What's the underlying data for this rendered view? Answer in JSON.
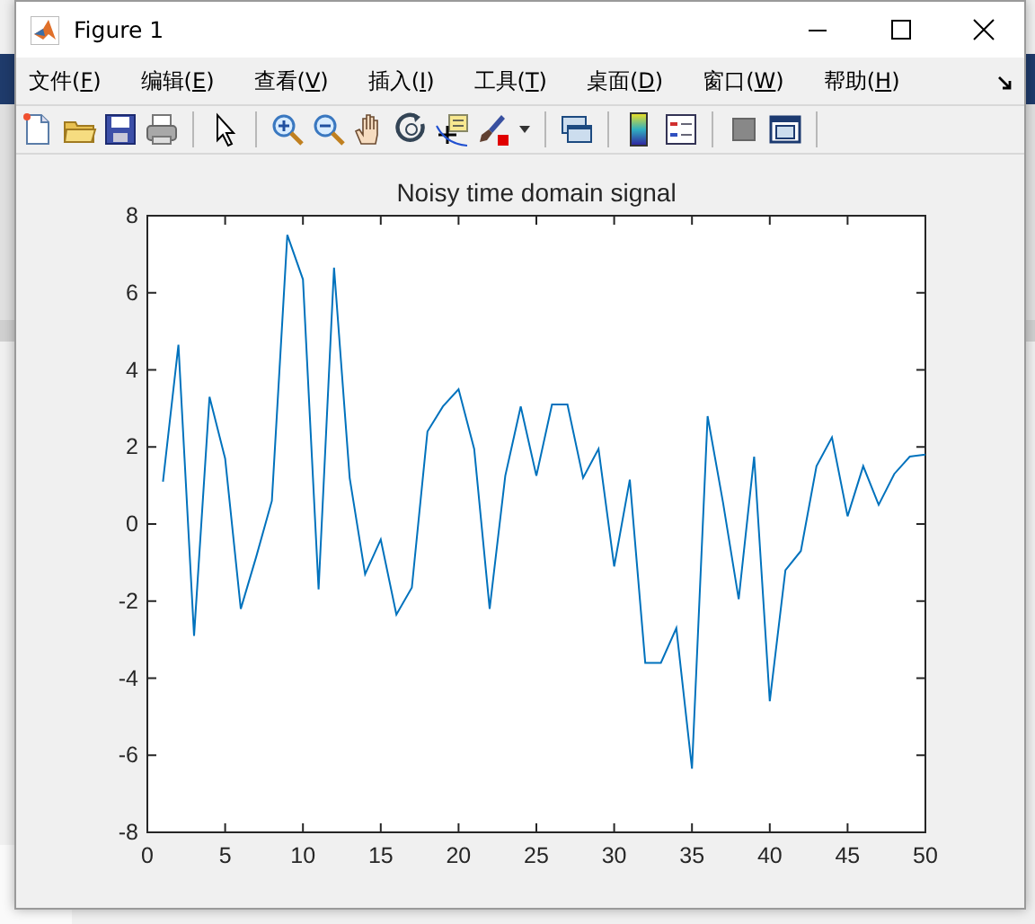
{
  "window": {
    "title": "Figure 1"
  },
  "menu": [
    {
      "label": "文件(F)"
    },
    {
      "label": "编辑(E)"
    },
    {
      "label": "查看(V)"
    },
    {
      "label": "插入(I)"
    },
    {
      "label": "工具(T)"
    },
    {
      "label": "桌面(D)"
    },
    {
      "label": "窗口(W)"
    },
    {
      "label": "帮助(H)"
    }
  ],
  "plot": {
    "chart_data": {
      "type": "line",
      "title": "Noisy time domain signal",
      "xlim": [
        0,
        50
      ],
      "ylim": [
        -8,
        8
      ],
      "xticks": [
        0,
        5,
        10,
        15,
        20,
        25,
        30,
        35,
        40,
        45,
        50
      ],
      "yticks": [
        -8,
        -6,
        -4,
        -2,
        0,
        2,
        4,
        6,
        8
      ],
      "x": [
        1,
        2,
        3,
        4,
        5,
        6,
        7,
        8,
        9,
        10,
        11,
        12,
        13,
        14,
        15,
        16,
        17,
        18,
        19,
        20,
        21,
        22,
        23,
        24,
        25,
        26,
        27,
        28,
        29,
        30,
        31,
        32,
        33,
        34,
        35,
        36,
        37,
        38,
        39,
        40,
        41,
        42,
        43,
        44,
        45,
        46,
        47,
        48,
        49,
        50
      ],
      "series": [
        {
          "color": "#0072bd",
          "values": [
            1.1,
            4.65,
            -2.9,
            3.3,
            1.7,
            -2.2,
            -0.85,
            0.6,
            7.5,
            6.35,
            -1.7,
            6.65,
            1.2,
            -1.3,
            -0.4,
            -2.35,
            -1.65,
            2.4,
            3.05,
            3.5,
            1.95,
            -2.2,
            1.25,
            3.05,
            1.25,
            3.1,
            3.1,
            1.2,
            1.95,
            -1.1,
            1.15,
            -3.6,
            -3.6,
            -2.7,
            -6.35,
            2.8,
            0.55,
            -1.95,
            1.75,
            -4.6,
            -1.2,
            -0.7,
            1.5,
            2.25,
            0.2,
            1.5,
            0.5,
            1.3,
            1.75,
            1.8
          ]
        }
      ]
    }
  }
}
